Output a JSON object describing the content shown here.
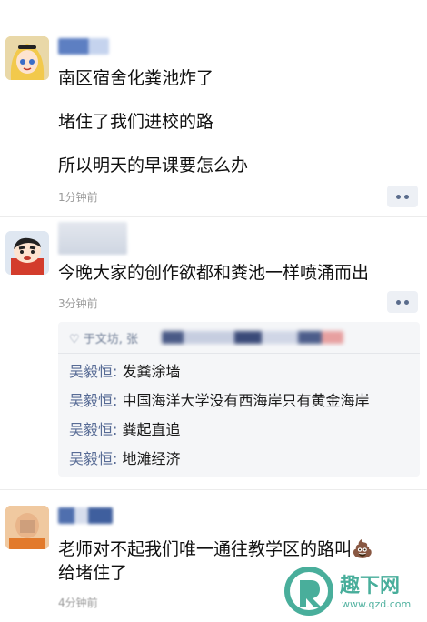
{
  "posts": [
    {
      "lines": [
        "南区宿舍化粪池炸了",
        "堵住了我们进校的路",
        "所以明天的早课要怎么办"
      ],
      "time": "1分钟前"
    },
    {
      "lines": [
        "今晚大家的创作欲都和粪池一样喷涌而出"
      ],
      "time": "3分钟前",
      "likes": "♡ 于文坊, 张",
      "replies": [
        {
          "name": "吴毅恒:",
          "text": " 发粪涂墙"
        },
        {
          "name": "吴毅恒:",
          "text": " 中国海洋大学没有西海岸只有黄金海岸"
        },
        {
          "name": "吴毅恒:",
          "text": " 粪起直追"
        },
        {
          "name": "吴毅恒:",
          "text": " 地滩经济"
        }
      ]
    },
    {
      "lines": [
        "老师对不起我们唯一通往教学区的路叫💩",
        "给堵住了"
      ],
      "time": "4分钟前"
    }
  ],
  "watermark": {
    "brand": "趣下网",
    "url": "www.qzd.com"
  },
  "colors": {
    "accent": "#576b95",
    "dots": "#5a6c8c",
    "watermark": "#29a08a"
  }
}
